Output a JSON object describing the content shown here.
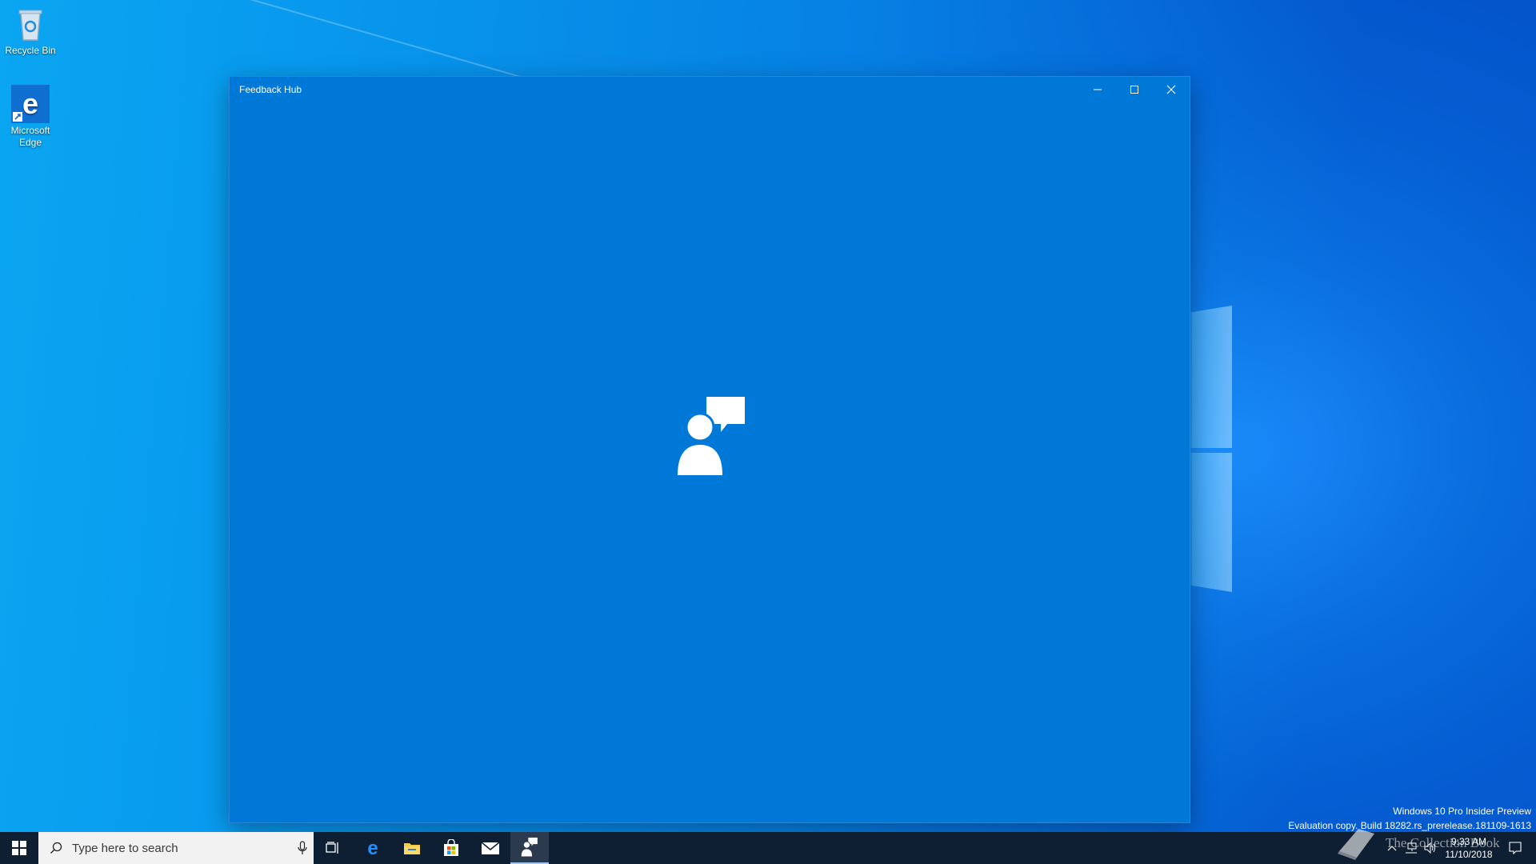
{
  "desktop": {
    "icons": [
      {
        "label": "Recycle Bin"
      },
      {
        "label": "Microsoft Edge"
      }
    ],
    "watermark": {
      "line1": "Windows 10 Pro Insider Preview",
      "line2": "Evaluation copy. Build 18282.rs_prerelease.181109-1613",
      "overlay_text": "The Collection Book"
    }
  },
  "window": {
    "title": "Feedback Hub",
    "accent_color": "#0078d7",
    "splash_icon": "feedback-person-speech-icon",
    "controls": [
      "minimize-icon",
      "maximize-icon",
      "close-icon"
    ]
  },
  "taskbar": {
    "search": {
      "placeholder": "Type here to search"
    },
    "apps": [
      {
        "icon": "task-view-icon"
      },
      {
        "icon": "edge-icon"
      },
      {
        "icon": "file-explorer-icon"
      },
      {
        "icon": "store-icon"
      },
      {
        "icon": "mail-icon"
      },
      {
        "icon": "feedback-hub-icon",
        "active": true
      }
    ],
    "clock": {
      "time": "9:33 AM",
      "date": "11/10/2018"
    }
  }
}
